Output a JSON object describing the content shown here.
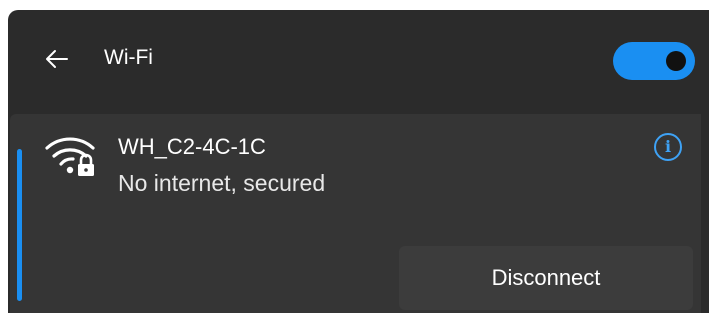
{
  "header": {
    "back_icon": "arrow-left-icon",
    "title": "Wi-Fi",
    "wifi_toggle": {
      "state": "on",
      "color": "#1a8ff2"
    }
  },
  "network": {
    "icon": "wifi-secured-lock-icon",
    "name": "WH_C2-4C-1C",
    "status": "No internet, secured",
    "info_icon": "info-icon",
    "accent_color": "#1a8ff2",
    "disconnect_label": "Disconnect"
  },
  "colors": {
    "panel_bg": "#2b2b2b",
    "card_bg": "#353535",
    "button_bg": "#3c3c3c",
    "accent": "#1a8ff2"
  }
}
